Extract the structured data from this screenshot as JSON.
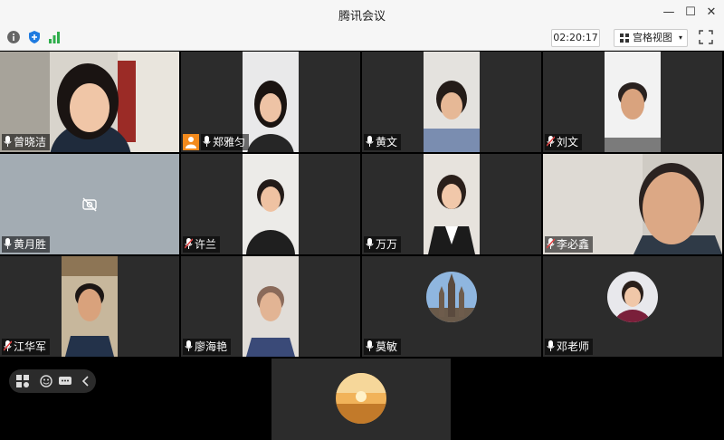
{
  "window": {
    "title": "腾讯会议",
    "minimize": "—",
    "maximize": "☐",
    "close": "✕"
  },
  "toolbar": {
    "timer": "02:20:17",
    "view_label": "宫格视图",
    "view_caret": "▾"
  },
  "participants": [
    {
      "name": "曾晓洁",
      "muted": false,
      "active": true
    },
    {
      "name": "郑雅匀",
      "muted": false,
      "host": true
    },
    {
      "name": "黄文",
      "muted": false
    },
    {
      "name": "刘文",
      "muted": true
    },
    {
      "name": "黄月胜",
      "muted": false,
      "camera_off": true
    },
    {
      "name": "许兰",
      "muted": true
    },
    {
      "name": "万万",
      "muted": false
    },
    {
      "name": "李必鑫",
      "muted": true
    },
    {
      "name": "江华军",
      "muted": true
    },
    {
      "name": "廖海艳",
      "muted": false
    },
    {
      "name": "莫敏",
      "muted": false
    },
    {
      "name": "邓老师",
      "muted": false
    }
  ],
  "colors": {
    "accent_active": "#3dbb5a",
    "host_badge": "#f28a1d",
    "muted_mic": "#e04040"
  }
}
